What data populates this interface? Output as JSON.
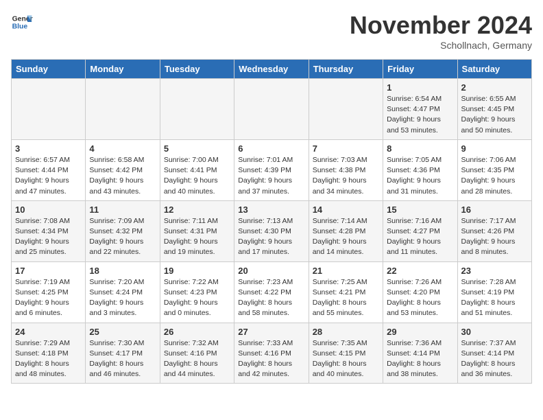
{
  "logo": {
    "line1": "General",
    "line2": "Blue"
  },
  "title": "November 2024",
  "location": "Schollnach, Germany",
  "headers": [
    "Sunday",
    "Monday",
    "Tuesday",
    "Wednesday",
    "Thursday",
    "Friday",
    "Saturday"
  ],
  "weeks": [
    [
      {
        "day": "",
        "details": ""
      },
      {
        "day": "",
        "details": ""
      },
      {
        "day": "",
        "details": ""
      },
      {
        "day": "",
        "details": ""
      },
      {
        "day": "",
        "details": ""
      },
      {
        "day": "1",
        "details": "Sunrise: 6:54 AM\nSunset: 4:47 PM\nDaylight: 9 hours\nand 53 minutes."
      },
      {
        "day": "2",
        "details": "Sunrise: 6:55 AM\nSunset: 4:45 PM\nDaylight: 9 hours\nand 50 minutes."
      }
    ],
    [
      {
        "day": "3",
        "details": "Sunrise: 6:57 AM\nSunset: 4:44 PM\nDaylight: 9 hours\nand 47 minutes."
      },
      {
        "day": "4",
        "details": "Sunrise: 6:58 AM\nSunset: 4:42 PM\nDaylight: 9 hours\nand 43 minutes."
      },
      {
        "day": "5",
        "details": "Sunrise: 7:00 AM\nSunset: 4:41 PM\nDaylight: 9 hours\nand 40 minutes."
      },
      {
        "day": "6",
        "details": "Sunrise: 7:01 AM\nSunset: 4:39 PM\nDaylight: 9 hours\nand 37 minutes."
      },
      {
        "day": "7",
        "details": "Sunrise: 7:03 AM\nSunset: 4:38 PM\nDaylight: 9 hours\nand 34 minutes."
      },
      {
        "day": "8",
        "details": "Sunrise: 7:05 AM\nSunset: 4:36 PM\nDaylight: 9 hours\nand 31 minutes."
      },
      {
        "day": "9",
        "details": "Sunrise: 7:06 AM\nSunset: 4:35 PM\nDaylight: 9 hours\nand 28 minutes."
      }
    ],
    [
      {
        "day": "10",
        "details": "Sunrise: 7:08 AM\nSunset: 4:34 PM\nDaylight: 9 hours\nand 25 minutes."
      },
      {
        "day": "11",
        "details": "Sunrise: 7:09 AM\nSunset: 4:32 PM\nDaylight: 9 hours\nand 22 minutes."
      },
      {
        "day": "12",
        "details": "Sunrise: 7:11 AM\nSunset: 4:31 PM\nDaylight: 9 hours\nand 19 minutes."
      },
      {
        "day": "13",
        "details": "Sunrise: 7:13 AM\nSunset: 4:30 PM\nDaylight: 9 hours\nand 17 minutes."
      },
      {
        "day": "14",
        "details": "Sunrise: 7:14 AM\nSunset: 4:28 PM\nDaylight: 9 hours\nand 14 minutes."
      },
      {
        "day": "15",
        "details": "Sunrise: 7:16 AM\nSunset: 4:27 PM\nDaylight: 9 hours\nand 11 minutes."
      },
      {
        "day": "16",
        "details": "Sunrise: 7:17 AM\nSunset: 4:26 PM\nDaylight: 9 hours\nand 8 minutes."
      }
    ],
    [
      {
        "day": "17",
        "details": "Sunrise: 7:19 AM\nSunset: 4:25 PM\nDaylight: 9 hours\nand 6 minutes."
      },
      {
        "day": "18",
        "details": "Sunrise: 7:20 AM\nSunset: 4:24 PM\nDaylight: 9 hours\nand 3 minutes."
      },
      {
        "day": "19",
        "details": "Sunrise: 7:22 AM\nSunset: 4:23 PM\nDaylight: 9 hours\nand 0 minutes."
      },
      {
        "day": "20",
        "details": "Sunrise: 7:23 AM\nSunset: 4:22 PM\nDaylight: 8 hours\nand 58 minutes."
      },
      {
        "day": "21",
        "details": "Sunrise: 7:25 AM\nSunset: 4:21 PM\nDaylight: 8 hours\nand 55 minutes."
      },
      {
        "day": "22",
        "details": "Sunrise: 7:26 AM\nSunset: 4:20 PM\nDaylight: 8 hours\nand 53 minutes."
      },
      {
        "day": "23",
        "details": "Sunrise: 7:28 AM\nSunset: 4:19 PM\nDaylight: 8 hours\nand 51 minutes."
      }
    ],
    [
      {
        "day": "24",
        "details": "Sunrise: 7:29 AM\nSunset: 4:18 PM\nDaylight: 8 hours\nand 48 minutes."
      },
      {
        "day": "25",
        "details": "Sunrise: 7:30 AM\nSunset: 4:17 PM\nDaylight: 8 hours\nand 46 minutes."
      },
      {
        "day": "26",
        "details": "Sunrise: 7:32 AM\nSunset: 4:16 PM\nDaylight: 8 hours\nand 44 minutes."
      },
      {
        "day": "27",
        "details": "Sunrise: 7:33 AM\nSunset: 4:16 PM\nDaylight: 8 hours\nand 42 minutes."
      },
      {
        "day": "28",
        "details": "Sunrise: 7:35 AM\nSunset: 4:15 PM\nDaylight: 8 hours\nand 40 minutes."
      },
      {
        "day": "29",
        "details": "Sunrise: 7:36 AM\nSunset: 4:14 PM\nDaylight: 8 hours\nand 38 minutes."
      },
      {
        "day": "30",
        "details": "Sunrise: 7:37 AM\nSunset: 4:14 PM\nDaylight: 8 hours\nand 36 minutes."
      }
    ]
  ]
}
